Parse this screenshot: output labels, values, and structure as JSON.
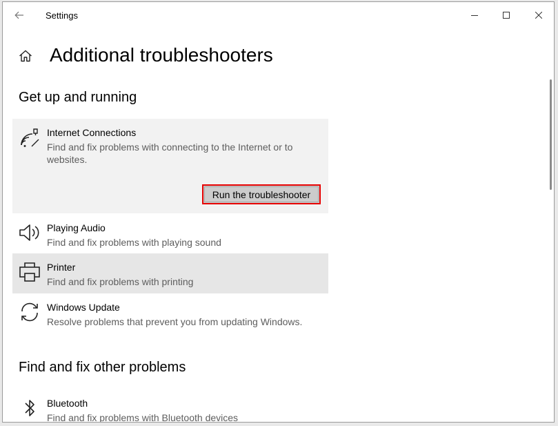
{
  "window": {
    "title": "Settings",
    "controls": [
      "minimize-icon",
      "maximize-icon",
      "close-icon"
    ]
  },
  "header": {
    "title": "Additional troubleshooters",
    "home_icon": "home-icon",
    "back_icon": "back-arrow-icon"
  },
  "sections": [
    {
      "title": "Get up and running",
      "items": [
        {
          "name": "Internet Connections",
          "description": "Find and fix problems with connecting to the Internet or to websites.",
          "icon": "network-icon",
          "expanded": true,
          "button_label": "Run the troubleshooter"
        },
        {
          "name": "Playing Audio",
          "description": "Find and fix problems with playing sound",
          "icon": "speaker-icon"
        },
        {
          "name": "Printer",
          "description": "Find and fix problems with printing",
          "icon": "printer-icon"
        },
        {
          "name": "Windows Update",
          "description": "Resolve problems that prevent you from updating Windows.",
          "icon": "refresh-icon"
        }
      ]
    },
    {
      "title": "Find and fix other problems",
      "items": [
        {
          "name": "Bluetooth",
          "description": "Find and fix problems with Bluetooth devices",
          "icon": "bluetooth-icon"
        }
      ]
    }
  ],
  "colors": {
    "highlight_border": "#e60000",
    "expanded_bg": "#f2f2f2",
    "hover_bg": "#e6e6e6",
    "button_bg": "#cccccc"
  }
}
